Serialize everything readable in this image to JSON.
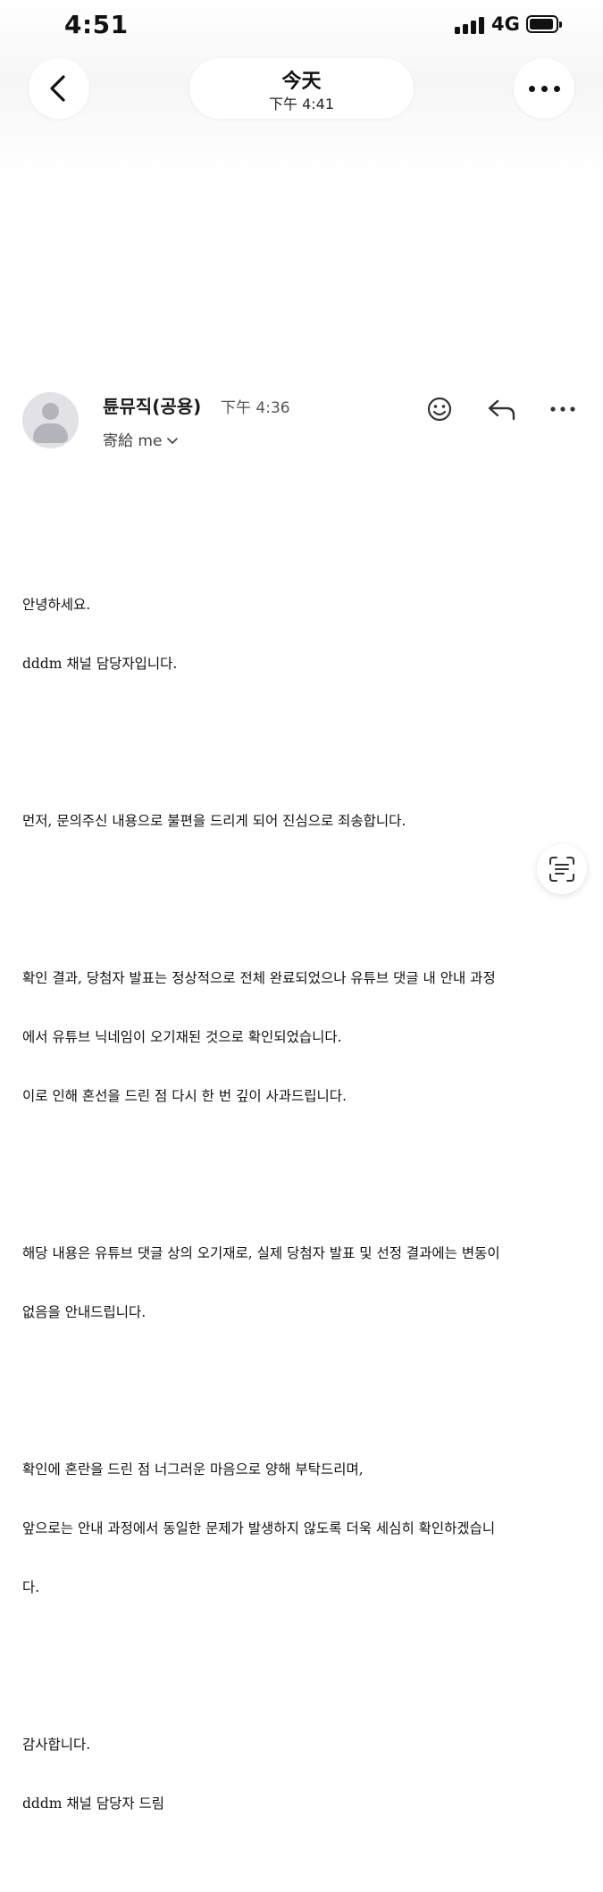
{
  "status_bar": {
    "time": "4:51",
    "network": "4G",
    "signal_bars": 4,
    "battery_level": 0.85
  },
  "nav": {
    "title": "今天",
    "subtitle": "下午 4:41",
    "back_icon": "chevron-left-icon",
    "more_icon": "more-horizontal-icon"
  },
  "message": {
    "sender": "튠뮤직(공용)",
    "time": "下午 4:36",
    "recipient": "寄給 me",
    "actions": [
      "emoji-icon",
      "reply-icon",
      "more-horizontal-icon"
    ],
    "paragraphs": [
      [
        "안녕하세요.",
        "dddm 채널 담당자입니다."
      ],
      [
        "먼저, 문의주신 내용으로 불편을 드리게 되어 진심으로 죄송합니다."
      ],
      [
        "확인 결과, 당첨자 발표는 정상적으로 전체 완료되었으나 유튜브 댓글 내 안내 과정",
        "에서 유튜브 닉네임이 오기재된 것으로 확인되었습니다.",
        "이로 인해 혼선을 드린 점 다시 한 번 깊이 사과드립니다."
      ],
      [
        "해당 내용은 유튜브 댓글 상의 오기재로, 실제 당첨자 발표 및 선정 결과에는 변동이",
        "없음을 안내드립니다."
      ],
      [
        "확인에 혼란을 드린 점 너그러운 마음으로 양해 부탁드리며,",
        "앞으로는 안내 과정에서 동일한 문제가 발생하지 않도록 더욱 세심히 확인하겠습니",
        "다."
      ],
      [
        "감사합니다.",
        "dddm 채널 담당자 드림"
      ]
    ]
  },
  "floating": {
    "icon": "text-scan-icon"
  }
}
